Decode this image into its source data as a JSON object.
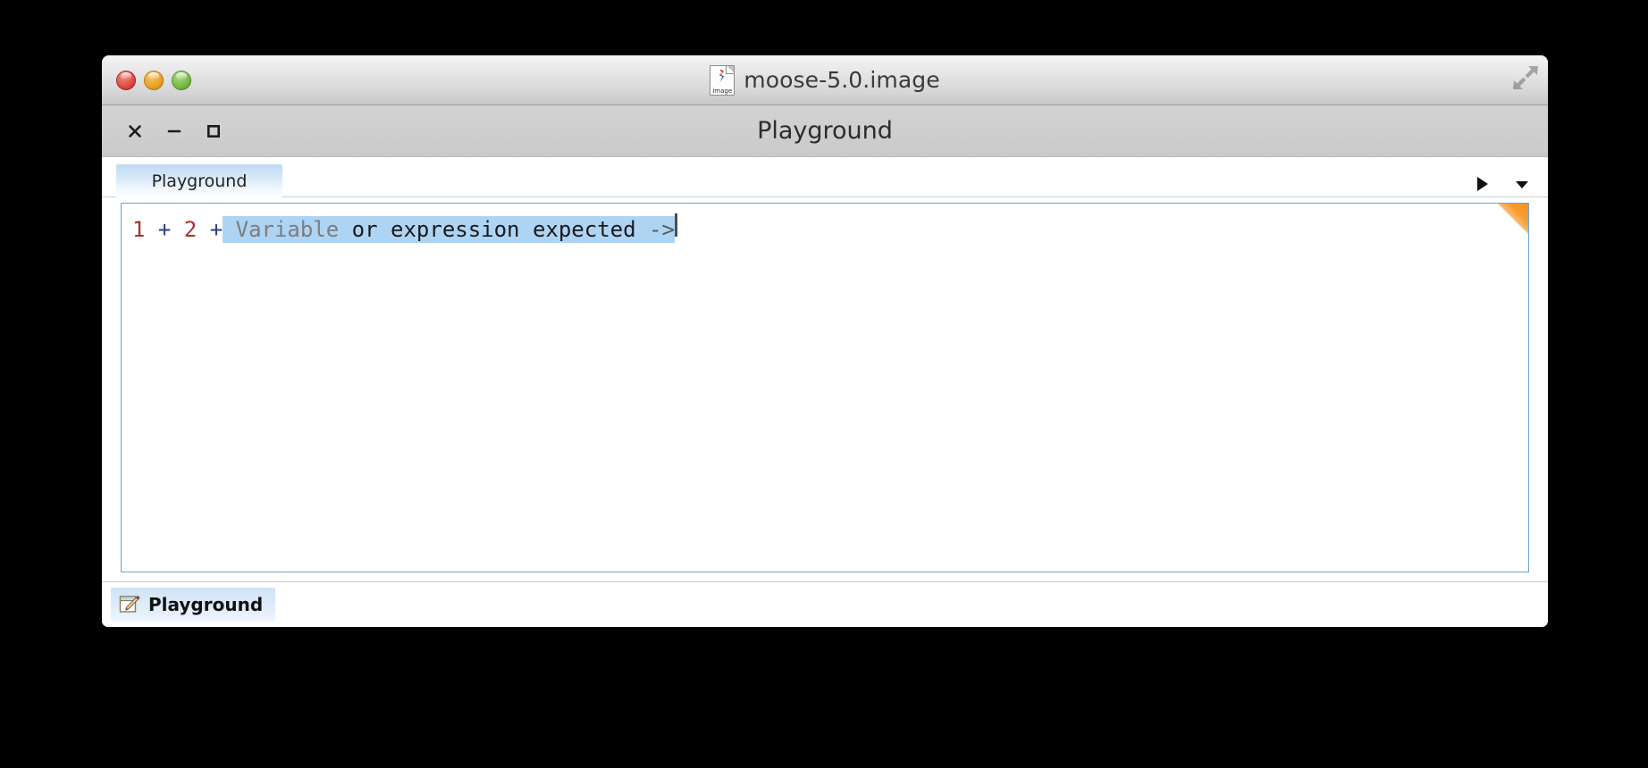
{
  "os_window": {
    "title": "moose-5.0.image",
    "doc_icon_label": "image",
    "doc_icon_name": "image-document-icon",
    "traffic_lights": [
      {
        "name": "close-button",
        "color": "#e04b44",
        "label": "Close"
      },
      {
        "name": "minimize-button",
        "color": "#e8a326",
        "label": "Minimize"
      },
      {
        "name": "zoom-button",
        "color": "#77bd4a",
        "label": "Zoom"
      }
    ],
    "resize_icon": "resize-expand-icon"
  },
  "inner_window": {
    "title": "Playground",
    "controls": [
      {
        "name": "window-close-button",
        "glyph": "close-icon",
        "label": "Close"
      },
      {
        "name": "window-minimize-button",
        "glyph": "minimize-icon",
        "label": "Minimize"
      },
      {
        "name": "window-maximize-button",
        "glyph": "maximize-icon",
        "label": "Maximize"
      }
    ]
  },
  "tabs": [
    {
      "label": "Playground",
      "active": true
    }
  ],
  "tab_actions": [
    {
      "name": "run-button",
      "icon": "play-icon",
      "label": "Do it"
    },
    {
      "name": "more-menu-button",
      "icon": "chevron-down-icon",
      "label": "More"
    }
  ],
  "editor": {
    "full_text": "1 + 2 + Variable or expression expected ->",
    "tokens": [
      {
        "text": "1",
        "kind": "number",
        "color": "#a8332a"
      },
      {
        "text": " ",
        "kind": "space"
      },
      {
        "text": "+",
        "kind": "operator",
        "color": "#2b3f8c"
      },
      {
        "text": " ",
        "kind": "space"
      },
      {
        "text": "2",
        "kind": "number",
        "color": "#a8332a"
      },
      {
        "text": " ",
        "kind": "space"
      },
      {
        "text": "+",
        "kind": "operator",
        "color": "#2b3f8c"
      }
    ],
    "error_highlight": {
      "prefix": " ",
      "hint_word": "Variable",
      "message": " or expression expected ",
      "arrow": "->",
      "background": "#aed4f4",
      "hint_color": "#7d7d7d",
      "message_color": "#1a1a1a"
    },
    "caret_visible": true,
    "border_color": "#6ca3d8",
    "dirty_marker_color": "#f7941e"
  },
  "taskbar": {
    "items": [
      {
        "label": "Playground",
        "icon": "pencil-edit-icon",
        "active": true
      }
    ]
  }
}
